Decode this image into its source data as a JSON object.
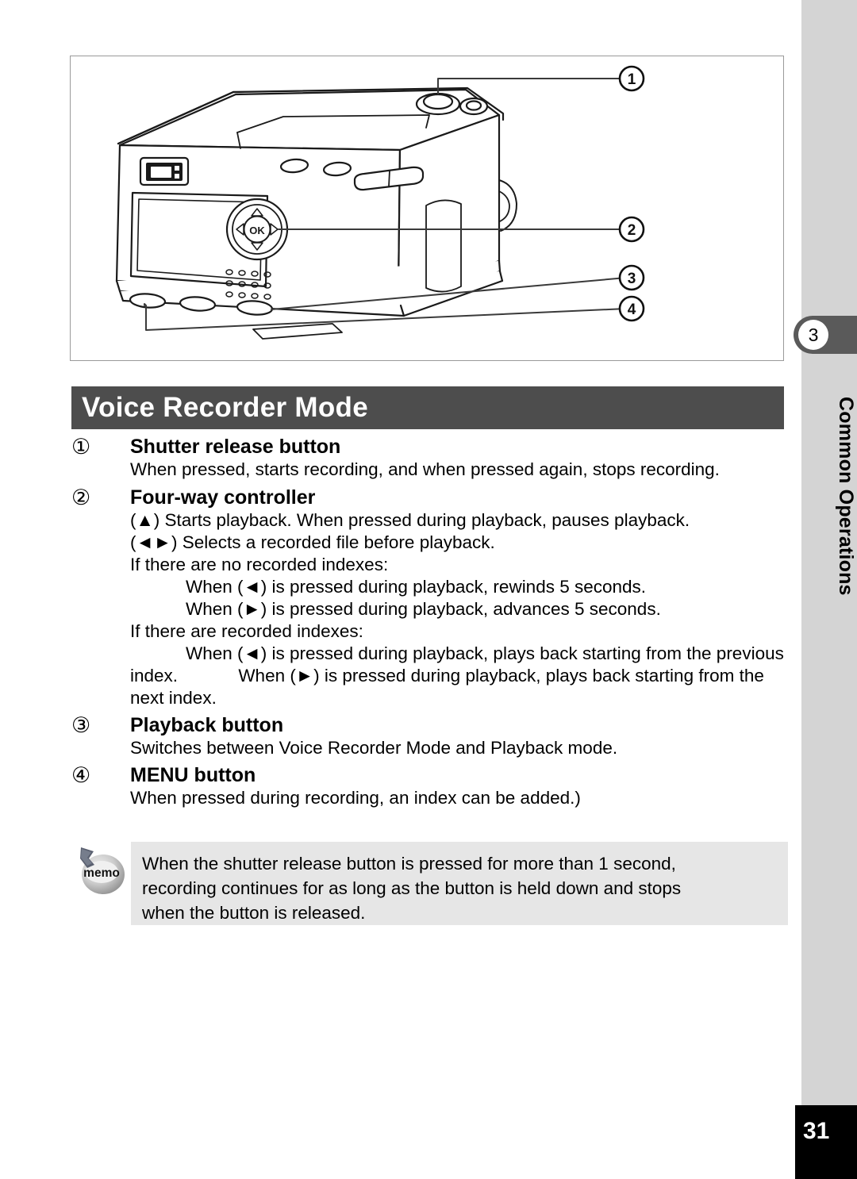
{
  "page": {
    "number": "31",
    "chapter_number": "3",
    "chapter_label": "Common Operations"
  },
  "heading": {
    "title": "Voice Recorder Mode"
  },
  "illustration": {
    "alt_name": "digital-camera-rear-view",
    "callouts": [
      "①",
      "②",
      "③",
      "④"
    ],
    "ok_label": "OK"
  },
  "items": [
    {
      "marker": "①",
      "title": "Shutter release button",
      "lines": [
        {
          "text": "When pressed, starts recording, and when pressed again, stops recording.",
          "indent": 0
        }
      ]
    },
    {
      "marker": "②",
      "title": "Four-way controller",
      "lines": [
        {
          "text": "(▲) Starts playback. When pressed during playback, pauses playback.",
          "indent": 0
        },
        {
          "text": "(◄►) Selects a recorded file before playback.",
          "indent": 0
        },
        {
          "text": "If there are no recorded indexes:",
          "indent": 0
        },
        {
          "text": "When (◄) is pressed during playback, rewinds 5 seconds.",
          "indent": 1
        },
        {
          "text": "When (►) is pressed during playback, advances 5 seconds.",
          "indent": 1
        },
        {
          "text": "If there are recorded indexes:",
          "indent": 0
        },
        {
          "text": "When (◄) is pressed during playback, plays back starting from the previous index.",
          "indent": 2
        },
        {
          "text": "When (►) is pressed during playback, plays back starting from the next index.",
          "indent": 2
        }
      ]
    },
    {
      "marker": "③",
      "title": "Playback button",
      "lines": [
        {
          "text": "Switches between Voice Recorder Mode and Playback mode.",
          "indent": 0
        }
      ]
    },
    {
      "marker": "④",
      "title": "MENU button",
      "lines": [
        {
          "text": "When pressed during recording, an index can be added.)",
          "indent": 0
        }
      ]
    }
  ],
  "memo": {
    "icon_label": "memo",
    "lines": [
      "When the shutter release button is pressed for more than 1 second,",
      "recording continues for as long as the button is held down and stops",
      "when the button is released."
    ]
  },
  "colors": {
    "heading_bar": "#4d4d4d",
    "side_strip": "#d4d4d4",
    "side_tab": "#5a5a5a",
    "memo_bg": "#e6e6e6",
    "page_box": "#000000"
  }
}
